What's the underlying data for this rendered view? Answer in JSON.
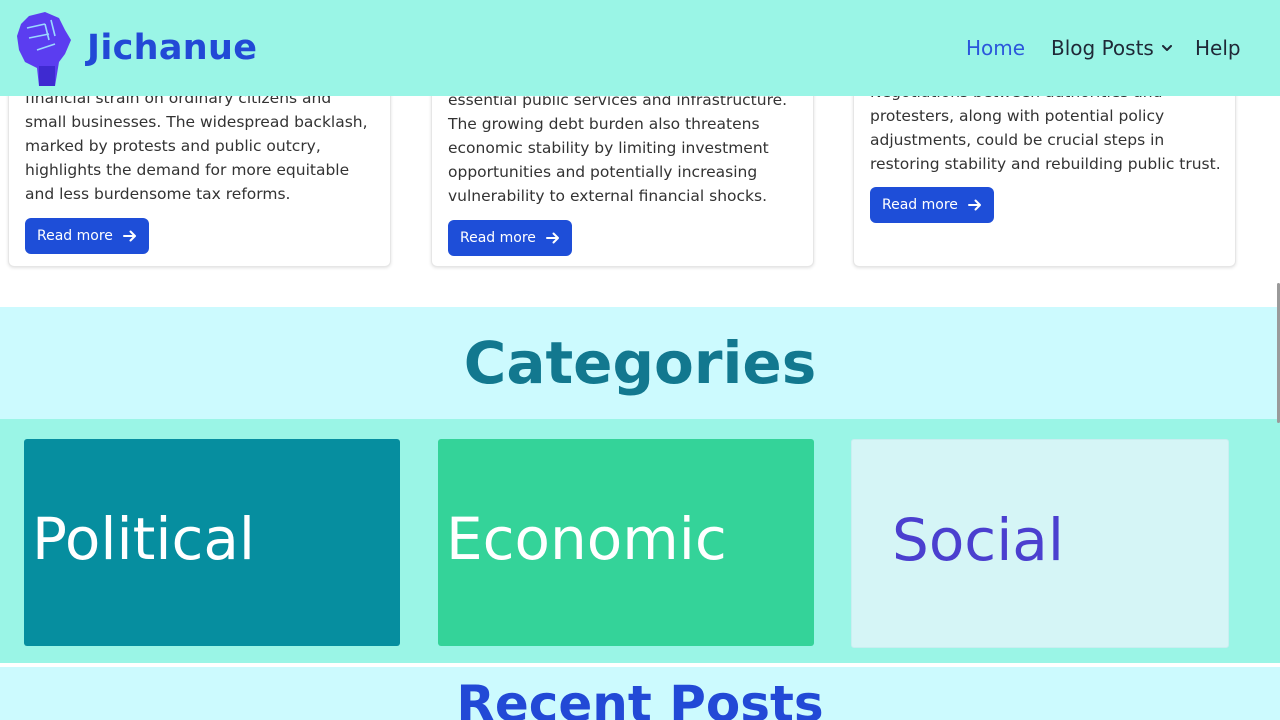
{
  "header": {
    "brand": "Jichanue",
    "nav": {
      "home": "Home",
      "blog_posts": "Blog Posts",
      "help": "Help"
    }
  },
  "posts": [
    {
      "text": "financial strain on ordinary citizens and small businesses. The widespread backlash, marked by protests and public outcry, highlights the demand for more equitable and less burdensome tax reforms.",
      "button": "Read more"
    },
    {
      "text": "essential public services and infrastructure. The growing debt burden also threatens economic stability by limiting investment opportunities and potentially increasing vulnerability to external financial shocks.",
      "button": "Read more"
    },
    {
      "text": "Negotiations between authorities and protesters, along with potential policy adjustments, could be crucial steps in restoring stability and rebuilding public trust.",
      "button": "Read more"
    }
  ],
  "categories": {
    "title": "Categories",
    "items": [
      {
        "label": "Political",
        "bg": "#068e9f",
        "color": "#ffffff"
      },
      {
        "label": "Economic",
        "bg": "#34d399",
        "color": "#ffffff"
      },
      {
        "label": "Social",
        "bg": "#d5f5f6",
        "color": "#4b3fcf"
      }
    ]
  },
  "recent": {
    "title": "Recent Posts"
  },
  "colors": {
    "header_bg": "#9af5e6",
    "brand": "#2249d6",
    "accent": "#1e4ed8"
  }
}
